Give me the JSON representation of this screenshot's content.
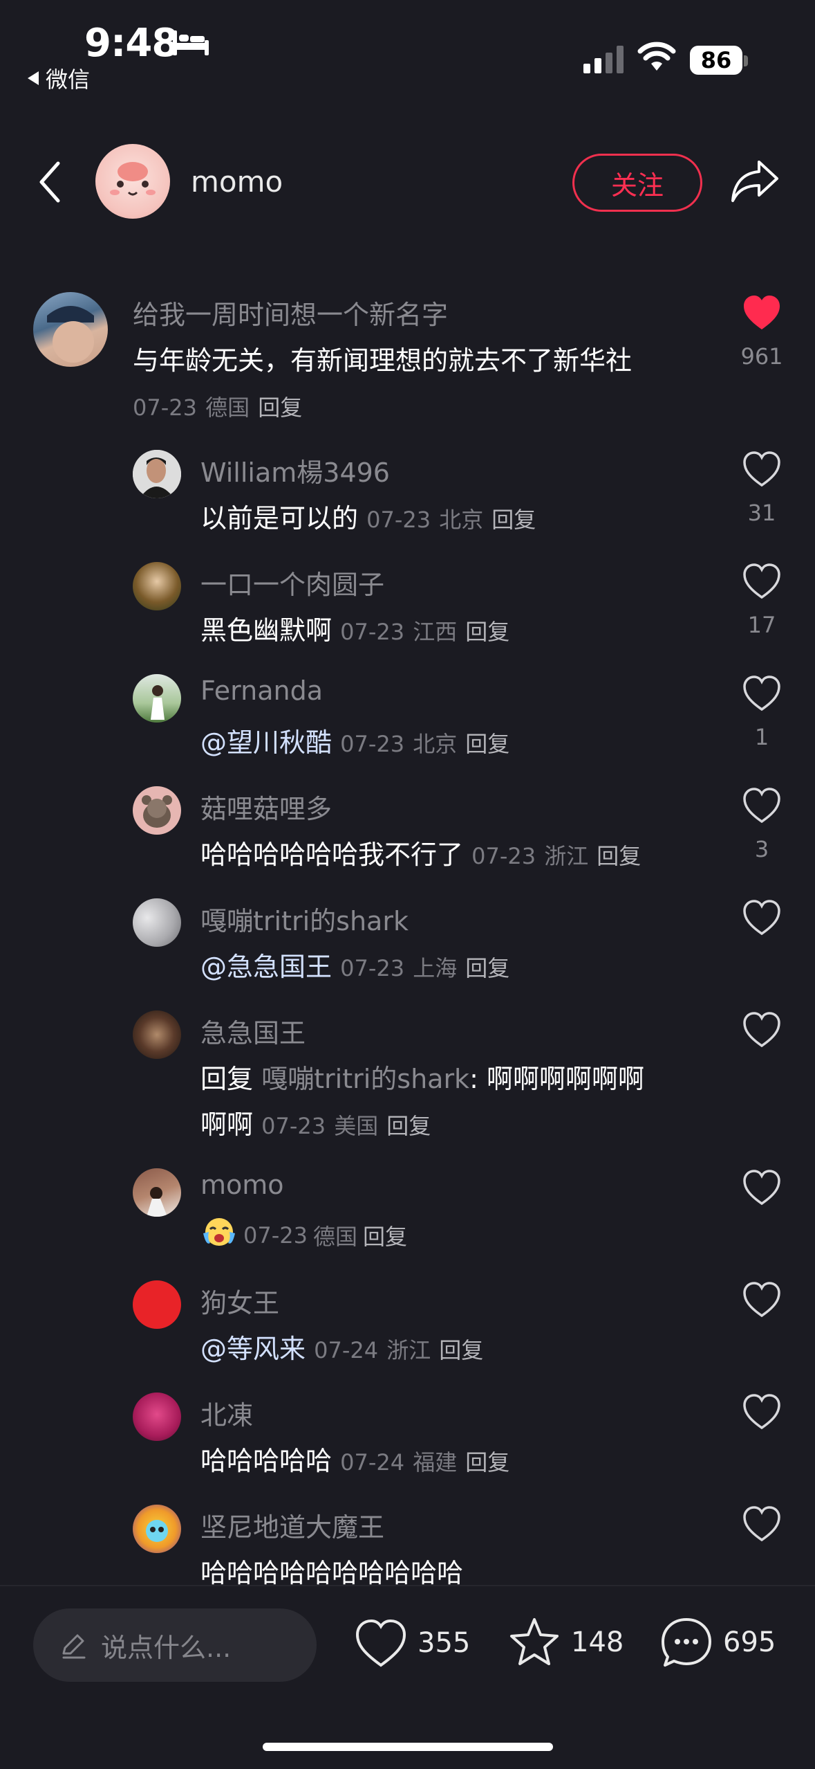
{
  "status_bar": {
    "time": "9:48",
    "back_app": "微信",
    "battery": "86"
  },
  "header": {
    "author_name": "momo",
    "follow_label": "关注"
  },
  "main_comment": {
    "username": "给我一周时间想一个新名字",
    "text": "与年龄无关，有新闻理想的就去不了新华社",
    "date": "07-23",
    "location": "德国",
    "reply_label": "回复",
    "likes": "961",
    "liked": true,
    "like_color": "#ff2b4f"
  },
  "replies": [
    {
      "username": "William楊3496",
      "text": "以前是可以的",
      "date": "07-23",
      "location": "北京",
      "reply_label": "回复",
      "likes": "31"
    },
    {
      "username": "一口一个肉圆子",
      "text": "黑色幽默啊",
      "date": "07-23",
      "location": "江西",
      "reply_label": "回复",
      "likes": "17"
    },
    {
      "username": "Fernanda",
      "mention": "@望川秋酷",
      "date": "07-23",
      "location": "北京",
      "reply_label": "回复",
      "likes": "1"
    },
    {
      "username": "菇哩菇哩多",
      "text": "哈哈哈哈哈哈我不行了",
      "date": "07-23",
      "location": "浙江",
      "reply_label": "回复",
      "likes": "3"
    },
    {
      "username": "嘎嘣tritri的shark",
      "mention": "@急急国王",
      "date": "07-23",
      "location": "上海",
      "reply_label": "回复",
      "likes": ""
    },
    {
      "username": "急急国王",
      "reply_prefix": "回复",
      "reply_target": "嘎嘣tritri的shark",
      "text_line1": ": 啊啊啊啊啊啊",
      "text_line2": "啊啊",
      "date": "07-23",
      "location": "美国",
      "reply_label": "回复",
      "likes": ""
    },
    {
      "username": "momo",
      "emoji": "crying-face-emoji",
      "date": "07-23",
      "location": "德国",
      "reply_label": "回复",
      "likes": ""
    },
    {
      "username": "狗女王",
      "mention": "@等风来",
      "date": "07-24",
      "location": "浙江",
      "reply_label": "回复",
      "likes": ""
    },
    {
      "username": "北凍",
      "text": "哈哈哈哈哈",
      "date": "07-24",
      "location": "福建",
      "reply_label": "回复",
      "likes": ""
    },
    {
      "username": "坚尼地道大魔王",
      "text": "哈哈哈哈哈哈哈哈哈哈",
      "likes": ""
    }
  ],
  "bottom_bar": {
    "input_placeholder": "说点什么...",
    "likes_count": "355",
    "favorites_count": "148",
    "comments_count": "695"
  },
  "colors": {
    "background": "#1b1b22",
    "accent": "#ff2f52",
    "muted_text": "#8a8a90"
  }
}
